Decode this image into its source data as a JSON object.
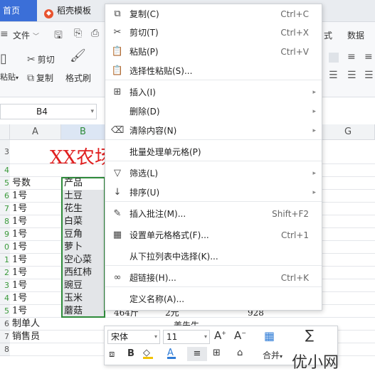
{
  "tabs": {
    "home": "首页",
    "template": "稻壳模板"
  },
  "ribbon": {
    "file": "文件",
    "cut": "剪切",
    "copy": "复制",
    "paste": "粘贴",
    "format_painter": "格式刷",
    "right_tab_1": "式",
    "right_tab_2": "数据"
  },
  "namebox": {
    "value": "B4"
  },
  "columns": [
    "A",
    "B",
    "G"
  ],
  "rows": [
    "3",
    "4",
    "5",
    "6",
    "7",
    "8",
    "9",
    "0",
    "1",
    "2",
    "3",
    "4",
    "5",
    "6",
    "7",
    "8"
  ],
  "title_cell": "XX农场",
  "col_a": [
    "号数",
    "1号",
    "1号",
    "1号",
    "1号",
    "1号",
    "1号",
    "1号",
    "1号",
    "1号",
    "1号",
    "制单人",
    "销售员"
  ],
  "col_b": [
    "产品",
    "土豆",
    "花生",
    "白菜",
    "豆角",
    "萝卜",
    "空心菜",
    "西红柿",
    "豌豆",
    "玉米",
    "蘑菇"
  ],
  "row14_extra": {
    "weight": "464斤",
    "price": "2元",
    "total": "928"
  },
  "row15_extra": "姜先生",
  "context_menu": [
    {
      "label": "复制(C)",
      "shortcut": "Ctrl+C",
      "icon": "copy-icon",
      "glyph": "⧉"
    },
    {
      "label": "剪切(T)",
      "shortcut": "Ctrl+X",
      "icon": "scissors-icon",
      "glyph": "✂"
    },
    {
      "label": "粘贴(P)",
      "shortcut": "Ctrl+V",
      "icon": "paste-icon",
      "glyph": "📋"
    },
    {
      "label": "选择性粘贴(S)...",
      "shortcut": "",
      "icon": "paste-special-icon",
      "glyph": "📋"
    },
    {
      "label": "插入(I)",
      "shortcut": "",
      "icon": "insert-icon",
      "glyph": "⊞",
      "submenu": true
    },
    {
      "label": "删除(D)",
      "shortcut": "",
      "icon": "",
      "glyph": "",
      "submenu": true
    },
    {
      "label": "清除内容(N)",
      "shortcut": "",
      "icon": "eraser-icon",
      "glyph": "⌫",
      "submenu": true
    },
    {
      "label": "批量处理单元格(P)",
      "shortcut": "",
      "icon": "",
      "glyph": ""
    },
    {
      "label": "筛选(L)",
      "shortcut": "",
      "icon": "filter-icon",
      "glyph": "▽",
      "submenu": true
    },
    {
      "label": "排序(U)",
      "shortcut": "",
      "icon": "sort-icon",
      "glyph": "↓",
      "submenu": true
    },
    {
      "label": "插入批注(M)...",
      "shortcut": "Shift+F2",
      "icon": "comment-icon",
      "glyph": "✎"
    },
    {
      "label": "设置单元格格式(F)...",
      "shortcut": "Ctrl+1",
      "icon": "format-cells-icon",
      "glyph": "▦"
    },
    {
      "label": "从下拉列表中选择(K)...",
      "shortcut": "",
      "icon": "",
      "glyph": ""
    },
    {
      "label": "超链接(H)...",
      "shortcut": "Ctrl+K",
      "icon": "link-icon",
      "glyph": "∞"
    },
    {
      "label": "定义名称(A)...",
      "shortcut": "",
      "icon": "",
      "glyph": ""
    }
  ],
  "mini_toolbar": {
    "font": "宋体",
    "size": "11",
    "merge": "合并",
    "autosum": "∑"
  },
  "watermark": "优小网",
  "colors": {
    "accent": "#3b6fd8",
    "title_red": "#e02020",
    "selection_green": "#2e8b3a",
    "row_header_green": "#3a9a3a"
  }
}
